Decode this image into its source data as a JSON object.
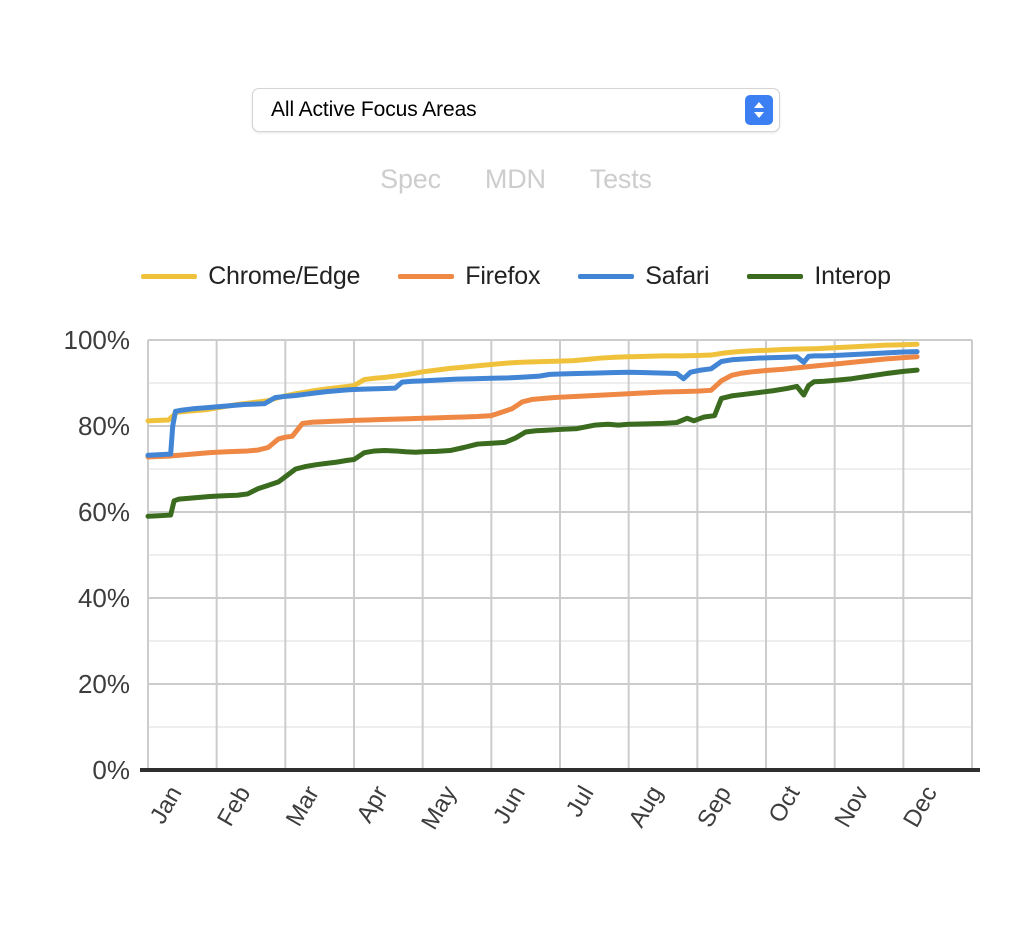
{
  "focus_select": {
    "value": "All Active Focus Areas",
    "stepper_icon": "stepper-updown-icon",
    "accent_color": "#3b7ff2"
  },
  "doc_links": [
    {
      "label": "Spec",
      "name": "spec"
    },
    {
      "label": "MDN",
      "name": "mdn"
    },
    {
      "label": "Tests",
      "name": "tests"
    }
  ],
  "chart_data": {
    "type": "line",
    "title": "",
    "subtitle": "",
    "xlabel": "",
    "ylabel": "",
    "ylim": [
      0,
      100
    ],
    "y_ticks": [
      "0%",
      "20%",
      "40%",
      "60%",
      "80%",
      "100%"
    ],
    "y_tick_values": [
      0,
      20,
      40,
      60,
      80,
      100
    ],
    "y_minor_step": 10,
    "grid": true,
    "legend_position": "top",
    "categories": [
      "Jan",
      "Feb",
      "Mar",
      "Apr",
      "May",
      "Jun",
      "Jul",
      "Aug",
      "Sep",
      "Oct",
      "Nov",
      "Dec"
    ],
    "x_tick_labels": [
      "Jan",
      "Feb",
      "Mar",
      "Apr",
      "May",
      "Jun",
      "Jul",
      "Aug",
      "Sep",
      "Oct",
      "Nov",
      "Dec"
    ],
    "x_tick_rotation": -60,
    "x_domain_months": [
      0,
      12
    ],
    "data_end_month": 11.2,
    "series": [
      {
        "name": "Chrome/Edge",
        "color": "#F0C23C",
        "points": [
          [
            0.0,
            81.2
          ],
          [
            0.15,
            81.3
          ],
          [
            0.3,
            81.4
          ],
          [
            0.42,
            83.2
          ],
          [
            0.55,
            83.4
          ],
          [
            0.7,
            83.6
          ],
          [
            0.85,
            83.8
          ],
          [
            1.0,
            84.2
          ],
          [
            1.15,
            84.6
          ],
          [
            1.3,
            85.0
          ],
          [
            1.45,
            85.3
          ],
          [
            1.6,
            85.6
          ],
          [
            1.75,
            85.9
          ],
          [
            1.9,
            86.6
          ],
          [
            2.0,
            87.0
          ],
          [
            2.15,
            87.5
          ],
          [
            2.3,
            87.9
          ],
          [
            2.45,
            88.3
          ],
          [
            2.6,
            88.6
          ],
          [
            2.75,
            88.9
          ],
          [
            2.9,
            89.2
          ],
          [
            3.0,
            89.4
          ],
          [
            3.15,
            90.8
          ],
          [
            3.3,
            91.1
          ],
          [
            3.45,
            91.3
          ],
          [
            3.6,
            91.6
          ],
          [
            3.75,
            91.9
          ],
          [
            3.9,
            92.3
          ],
          [
            4.0,
            92.6
          ],
          [
            4.2,
            93.0
          ],
          [
            4.4,
            93.4
          ],
          [
            4.6,
            93.7
          ],
          [
            4.8,
            94.0
          ],
          [
            5.0,
            94.3
          ],
          [
            5.2,
            94.6
          ],
          [
            5.4,
            94.8
          ],
          [
            5.6,
            94.9
          ],
          [
            5.8,
            95.0
          ],
          [
            6.0,
            95.1
          ],
          [
            6.2,
            95.2
          ],
          [
            6.4,
            95.5
          ],
          [
            6.6,
            95.8
          ],
          [
            6.8,
            96.0
          ],
          [
            7.0,
            96.1
          ],
          [
            7.25,
            96.2
          ],
          [
            7.5,
            96.3
          ],
          [
            7.75,
            96.3
          ],
          [
            8.0,
            96.4
          ],
          [
            8.2,
            96.5
          ],
          [
            8.4,
            97.0
          ],
          [
            8.6,
            97.3
          ],
          [
            8.8,
            97.5
          ],
          [
            9.0,
            97.6
          ],
          [
            9.25,
            97.8
          ],
          [
            9.5,
            97.9
          ],
          [
            9.75,
            98.0
          ],
          [
            10.0,
            98.2
          ],
          [
            10.25,
            98.4
          ],
          [
            10.5,
            98.6
          ],
          [
            10.75,
            98.8
          ],
          [
            11.0,
            98.9
          ],
          [
            11.2,
            99.0
          ]
        ]
      },
      {
        "name": "Firefox",
        "color": "#EE8844",
        "points": [
          [
            0.0,
            72.8
          ],
          [
            0.15,
            72.9
          ],
          [
            0.3,
            73.0
          ],
          [
            0.45,
            73.2
          ],
          [
            0.6,
            73.4
          ],
          [
            0.75,
            73.6
          ],
          [
            0.9,
            73.8
          ],
          [
            1.0,
            73.9
          ],
          [
            1.15,
            74.0
          ],
          [
            1.3,
            74.1
          ],
          [
            1.45,
            74.2
          ],
          [
            1.6,
            74.4
          ],
          [
            1.75,
            75.0
          ],
          [
            1.9,
            77.0
          ],
          [
            2.0,
            77.4
          ],
          [
            2.1,
            77.6
          ],
          [
            2.25,
            80.6
          ],
          [
            2.4,
            80.9
          ],
          [
            2.55,
            81.0
          ],
          [
            2.7,
            81.1
          ],
          [
            2.85,
            81.2
          ],
          [
            3.0,
            81.3
          ],
          [
            3.2,
            81.4
          ],
          [
            3.4,
            81.5
          ],
          [
            3.6,
            81.6
          ],
          [
            3.8,
            81.7
          ],
          [
            4.0,
            81.8
          ],
          [
            4.2,
            81.9
          ],
          [
            4.4,
            82.0
          ],
          [
            4.6,
            82.1
          ],
          [
            4.8,
            82.2
          ],
          [
            5.0,
            82.4
          ],
          [
            5.15,
            83.2
          ],
          [
            5.3,
            84.0
          ],
          [
            5.45,
            85.6
          ],
          [
            5.6,
            86.2
          ],
          [
            5.75,
            86.4
          ],
          [
            5.9,
            86.6
          ],
          [
            6.0,
            86.7
          ],
          [
            6.25,
            86.9
          ],
          [
            6.5,
            87.1
          ],
          [
            6.75,
            87.3
          ],
          [
            7.0,
            87.5
          ],
          [
            7.25,
            87.7
          ],
          [
            7.5,
            87.9
          ],
          [
            7.75,
            88.0
          ],
          [
            8.0,
            88.1
          ],
          [
            8.2,
            88.3
          ],
          [
            8.35,
            90.5
          ],
          [
            8.5,
            91.8
          ],
          [
            8.65,
            92.3
          ],
          [
            8.8,
            92.6
          ],
          [
            9.0,
            92.9
          ],
          [
            9.25,
            93.2
          ],
          [
            9.5,
            93.6
          ],
          [
            9.75,
            94.0
          ],
          [
            10.0,
            94.4
          ],
          [
            10.25,
            94.8
          ],
          [
            10.5,
            95.2
          ],
          [
            10.75,
            95.6
          ],
          [
            11.0,
            95.9
          ],
          [
            11.2,
            96.1
          ]
        ]
      },
      {
        "name": "Safari",
        "color": "#4285D5",
        "points": [
          [
            0.0,
            73.2
          ],
          [
            0.15,
            73.3
          ],
          [
            0.25,
            73.4
          ],
          [
            0.33,
            73.5
          ],
          [
            0.36,
            80.0
          ],
          [
            0.4,
            83.4
          ],
          [
            0.5,
            83.7
          ],
          [
            0.65,
            84.0
          ],
          [
            0.8,
            84.2
          ],
          [
            0.95,
            84.4
          ],
          [
            1.1,
            84.6
          ],
          [
            1.25,
            84.8
          ],
          [
            1.4,
            85.0
          ],
          [
            1.55,
            85.1
          ],
          [
            1.7,
            85.2
          ],
          [
            1.85,
            86.6
          ],
          [
            2.0,
            86.9
          ],
          [
            2.15,
            87.1
          ],
          [
            2.3,
            87.4
          ],
          [
            2.45,
            87.7
          ],
          [
            2.6,
            88.0
          ],
          [
            2.75,
            88.2
          ],
          [
            2.9,
            88.4
          ],
          [
            3.0,
            88.5
          ],
          [
            3.2,
            88.6
          ],
          [
            3.4,
            88.7
          ],
          [
            3.6,
            88.8
          ],
          [
            3.7,
            90.2
          ],
          [
            3.85,
            90.4
          ],
          [
            4.0,
            90.5
          ],
          [
            4.25,
            90.7
          ],
          [
            4.5,
            90.9
          ],
          [
            4.75,
            91.0
          ],
          [
            5.0,
            91.1
          ],
          [
            5.25,
            91.2
          ],
          [
            5.5,
            91.4
          ],
          [
            5.7,
            91.6
          ],
          [
            5.85,
            92.0
          ],
          [
            6.0,
            92.1
          ],
          [
            6.25,
            92.2
          ],
          [
            6.5,
            92.3
          ],
          [
            6.75,
            92.4
          ],
          [
            7.0,
            92.5
          ],
          [
            7.25,
            92.4
          ],
          [
            7.5,
            92.3
          ],
          [
            7.7,
            92.2
          ],
          [
            7.8,
            91.0
          ],
          [
            7.9,
            92.5
          ],
          [
            8.05,
            93.0
          ],
          [
            8.2,
            93.3
          ],
          [
            8.35,
            95.0
          ],
          [
            8.5,
            95.4
          ],
          [
            8.7,
            95.6
          ],
          [
            8.9,
            95.8
          ],
          [
            9.1,
            95.9
          ],
          [
            9.3,
            96.0
          ],
          [
            9.45,
            96.1
          ],
          [
            9.55,
            94.8
          ],
          [
            9.62,
            96.2
          ],
          [
            9.7,
            96.3
          ],
          [
            9.85,
            96.3
          ],
          [
            10.0,
            96.4
          ],
          [
            10.25,
            96.6
          ],
          [
            10.5,
            96.8
          ],
          [
            10.75,
            97.0
          ],
          [
            11.0,
            97.2
          ],
          [
            11.2,
            97.3
          ]
        ]
      },
      {
        "name": "Interop",
        "color": "#3A6B1E",
        "points": [
          [
            0.0,
            59.0
          ],
          [
            0.12,
            59.1
          ],
          [
            0.24,
            59.2
          ],
          [
            0.33,
            59.3
          ],
          [
            0.38,
            62.6
          ],
          [
            0.45,
            63.0
          ],
          [
            0.6,
            63.2
          ],
          [
            0.75,
            63.4
          ],
          [
            0.9,
            63.6
          ],
          [
            1.0,
            63.7
          ],
          [
            1.15,
            63.8
          ],
          [
            1.3,
            63.9
          ],
          [
            1.45,
            64.2
          ],
          [
            1.6,
            65.4
          ],
          [
            1.75,
            66.2
          ],
          [
            1.9,
            67.0
          ],
          [
            2.0,
            68.2
          ],
          [
            2.15,
            70.0
          ],
          [
            2.3,
            70.6
          ],
          [
            2.45,
            71.0
          ],
          [
            2.6,
            71.3
          ],
          [
            2.75,
            71.6
          ],
          [
            2.9,
            72.0
          ],
          [
            3.0,
            72.2
          ],
          [
            3.15,
            73.8
          ],
          [
            3.3,
            74.2
          ],
          [
            3.45,
            74.3
          ],
          [
            3.6,
            74.2
          ],
          [
            3.75,
            74.0
          ],
          [
            3.9,
            73.9
          ],
          [
            4.0,
            74.0
          ],
          [
            4.2,
            74.1
          ],
          [
            4.4,
            74.3
          ],
          [
            4.6,
            75.0
          ],
          [
            4.8,
            75.8
          ],
          [
            5.0,
            76.0
          ],
          [
            5.2,
            76.2
          ],
          [
            5.35,
            77.2
          ],
          [
            5.5,
            78.6
          ],
          [
            5.65,
            78.9
          ],
          [
            5.8,
            79.0
          ],
          [
            6.0,
            79.2
          ],
          [
            6.25,
            79.4
          ],
          [
            6.5,
            80.2
          ],
          [
            6.7,
            80.4
          ],
          [
            6.85,
            80.2
          ],
          [
            7.0,
            80.4
          ],
          [
            7.25,
            80.5
          ],
          [
            7.5,
            80.6
          ],
          [
            7.7,
            80.8
          ],
          [
            7.85,
            81.8
          ],
          [
            7.95,
            81.2
          ],
          [
            8.1,
            82.1
          ],
          [
            8.25,
            82.4
          ],
          [
            8.35,
            86.4
          ],
          [
            8.5,
            87.0
          ],
          [
            8.7,
            87.4
          ],
          [
            8.9,
            87.8
          ],
          [
            9.1,
            88.2
          ],
          [
            9.3,
            88.7
          ],
          [
            9.45,
            89.2
          ],
          [
            9.55,
            87.2
          ],
          [
            9.62,
            89.4
          ],
          [
            9.7,
            90.3
          ],
          [
            9.85,
            90.4
          ],
          [
            10.0,
            90.6
          ],
          [
            10.25,
            91.0
          ],
          [
            10.5,
            91.6
          ],
          [
            10.75,
            92.2
          ],
          [
            11.0,
            92.7
          ],
          [
            11.2,
            93.0
          ]
        ]
      }
    ]
  }
}
